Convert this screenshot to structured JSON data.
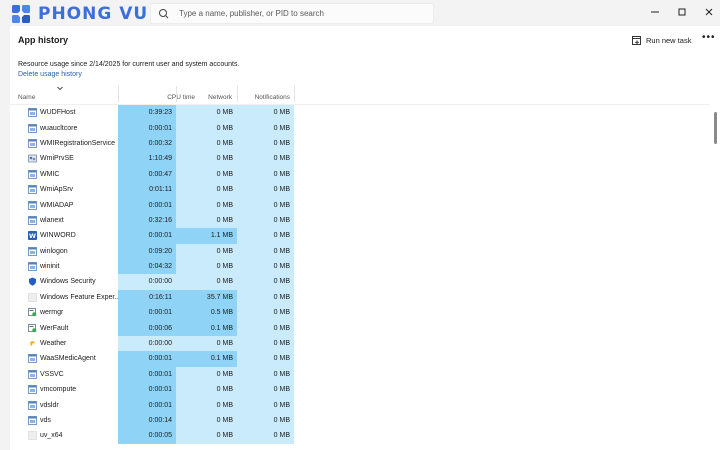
{
  "brand": {
    "text": "PHONG VU",
    "color": "#3d6fd8"
  },
  "search": {
    "placeholder": "Type a name, publisher, or PID to search"
  },
  "page": {
    "title": "App history",
    "run_new_task": "Run new task",
    "info": "Resource usage since 2/14/2025 for current user and system accounts.",
    "delete_link": "Delete usage history"
  },
  "columns": {
    "name": "Name",
    "cpu": "CPU time",
    "network": "Network",
    "notifications": "Notifications"
  },
  "colors": {
    "heat_strong": "#8fd4f6",
    "heat_light": "#c9ebfb",
    "heat_mid": "#a9def8",
    "link": "#2f5bb7"
  },
  "rows": [
    {
      "name": "WUDFHost",
      "icon": "app-window-icon",
      "cpu": "0:39:23",
      "network": "0 MB",
      "notifications": "0 MB",
      "cpu_level": "strong",
      "net_level": "light"
    },
    {
      "name": "wuaucltcore",
      "icon": "app-window-icon",
      "cpu": "0:00:01",
      "network": "0 MB",
      "notifications": "0 MB",
      "cpu_level": "strong",
      "net_level": "light"
    },
    {
      "name": "WMIRegistrationService",
      "icon": "app-window-icon",
      "cpu": "0:00:32",
      "network": "0 MB",
      "notifications": "0 MB",
      "cpu_level": "strong",
      "net_level": "light"
    },
    {
      "name": "WmiPrvSE",
      "icon": "gear-people-icon",
      "cpu": "1:10:49",
      "network": "0 MB",
      "notifications": "0 MB",
      "cpu_level": "strong",
      "net_level": "light"
    },
    {
      "name": "WMIC",
      "icon": "app-window-icon",
      "cpu": "0:00:47",
      "network": "0 MB",
      "notifications": "0 MB",
      "cpu_level": "strong",
      "net_level": "light"
    },
    {
      "name": "WmiApSrv",
      "icon": "app-window-icon",
      "cpu": "0:01:11",
      "network": "0 MB",
      "notifications": "0 MB",
      "cpu_level": "strong",
      "net_level": "light"
    },
    {
      "name": "WMIADAP",
      "icon": "app-window-icon",
      "cpu": "0:00:01",
      "network": "0 MB",
      "notifications": "0 MB",
      "cpu_level": "strong",
      "net_level": "light"
    },
    {
      "name": "wlanext",
      "icon": "app-window-icon",
      "cpu": "0:32:16",
      "network": "0 MB",
      "notifications": "0 MB",
      "cpu_level": "strong",
      "net_level": "light"
    },
    {
      "name": "WINWORD",
      "icon": "word-icon",
      "cpu": "0:00:01",
      "network": "1.1 MB",
      "notifications": "0 MB",
      "cpu_level": "strong",
      "net_level": "strong"
    },
    {
      "name": "winlogon",
      "icon": "app-window-icon",
      "cpu": "0:09:20",
      "network": "0 MB",
      "notifications": "0 MB",
      "cpu_level": "strong",
      "net_level": "light"
    },
    {
      "name": "wininit",
      "icon": "app-window-icon",
      "cpu": "0:04:32",
      "network": "0 MB",
      "notifications": "0 MB",
      "cpu_level": "strong",
      "net_level": "light"
    },
    {
      "name": "Windows Security",
      "icon": "shield-icon",
      "cpu": "0:00:00",
      "network": "0 MB",
      "notifications": "0 MB",
      "cpu_level": "light",
      "net_level": "light"
    },
    {
      "name": "Windows Feature Exper...",
      "icon": "blank-icon",
      "cpu": "0:16:11",
      "network": "35.7 MB",
      "notifications": "0 MB",
      "cpu_level": "strong",
      "net_level": "strong"
    },
    {
      "name": "wermgr",
      "icon": "error-report-icon",
      "cpu": "0:00:01",
      "network": "0.5 MB",
      "notifications": "0 MB",
      "cpu_level": "strong",
      "net_level": "strong"
    },
    {
      "name": "WerFault",
      "icon": "error-report-icon",
      "cpu": "0:00:06",
      "network": "0.1 MB",
      "notifications": "0 MB",
      "cpu_level": "strong",
      "net_level": "strong"
    },
    {
      "name": "Weather",
      "icon": "sun-icon",
      "cpu": "0:00:00",
      "network": "0 MB",
      "notifications": "0 MB",
      "cpu_level": "light",
      "net_level": "light"
    },
    {
      "name": "WaaSMedicAgent",
      "icon": "app-window-icon",
      "cpu": "0:00:01",
      "network": "0.1 MB",
      "notifications": "0 MB",
      "cpu_level": "strong",
      "net_level": "strong"
    },
    {
      "name": "VSSVC",
      "icon": "app-window-icon",
      "cpu": "0:00:01",
      "network": "0 MB",
      "notifications": "0 MB",
      "cpu_level": "strong",
      "net_level": "light"
    },
    {
      "name": "vmcompute",
      "icon": "app-window-icon",
      "cpu": "0:00:01",
      "network": "0 MB",
      "notifications": "0 MB",
      "cpu_level": "strong",
      "net_level": "light"
    },
    {
      "name": "vdsldr",
      "icon": "app-window-icon",
      "cpu": "0:00:01",
      "network": "0 MB",
      "notifications": "0 MB",
      "cpu_level": "strong",
      "net_level": "light"
    },
    {
      "name": "vds",
      "icon": "app-window-icon",
      "cpu": "0:00:14",
      "network": "0 MB",
      "notifications": "0 MB",
      "cpu_level": "strong",
      "net_level": "light"
    },
    {
      "name": "uv_x64",
      "icon": "blank-icon",
      "cpu": "0:00:05",
      "network": "0 MB",
      "notifications": "0 MB",
      "cpu_level": "strong",
      "net_level": "light"
    }
  ]
}
